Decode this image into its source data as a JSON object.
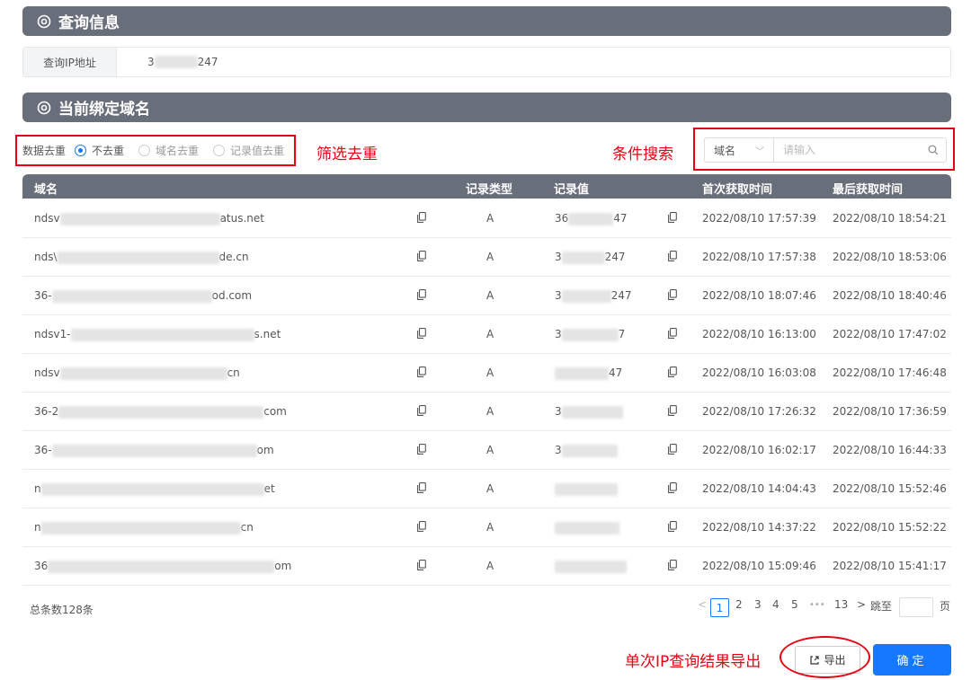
{
  "query_section": {
    "title": "查询信息",
    "ip_label": "查询IP地址",
    "ip_value_prefix": "3",
    "ip_value_suffix": "247"
  },
  "domains_section": {
    "title": "当前绑定域名"
  },
  "filter": {
    "label": "数据去重",
    "options": [
      {
        "label": "不去重",
        "checked": true
      },
      {
        "label": "域名去重",
        "checked": false
      },
      {
        "label": "记录值去重",
        "checked": false
      }
    ]
  },
  "annotations": {
    "filter": "筛选去重",
    "search": "条件搜索",
    "export": "单次IP查询结果导出"
  },
  "search": {
    "field": "域名",
    "placeholder": "请输入"
  },
  "table": {
    "columns": [
      "域名",
      "记录类型",
      "记录值",
      "首次获取时间",
      "最后获取时间"
    ],
    "rows": [
      {
        "domain_start": "ndsv",
        "domain_end": "atus.net",
        "type": "A",
        "value_start": "36",
        "value_end": "47",
        "first": "2022/08/10 17:57:39",
        "last": "2022/08/10 18:54:21"
      },
      {
        "domain_start": "nds\\",
        "domain_end": "de.cn",
        "type": "A",
        "value_start": "3",
        "value_end": "247",
        "first": "2022/08/10 17:57:38",
        "last": "2022/08/10 18:53:06"
      },
      {
        "domain_start": "36-",
        "domain_end": "od.com",
        "type": "A",
        "value_start": "3",
        "value_end": "247",
        "first": "2022/08/10 18:07:46",
        "last": "2022/08/10 18:40:46"
      },
      {
        "domain_start": "ndsv1-",
        "domain_end": "s.net",
        "type": "A",
        "value_start": "3",
        "value_end": "7",
        "first": "2022/08/10 16:13:00",
        "last": "2022/08/10 17:47:02"
      },
      {
        "domain_start": "ndsv",
        "domain_end": "cn",
        "type": "A",
        "value_start": "",
        "value_end": "47",
        "first": "2022/08/10 16:03:08",
        "last": "2022/08/10 17:46:48"
      },
      {
        "domain_start": "36-2",
        "domain_end": "com",
        "type": "A",
        "value_start": "3",
        "value_end": "",
        "first": "2022/08/10 17:26:32",
        "last": "2022/08/10 17:36:59"
      },
      {
        "domain_start": "36-",
        "domain_end": "om",
        "type": "A",
        "value_start": "3",
        "value_end": "",
        "first": "2022/08/10 16:02:17",
        "last": "2022/08/10 16:44:33"
      },
      {
        "domain_start": "n",
        "domain_end": "et",
        "type": "A",
        "value_start": "",
        "value_end": "",
        "first": "2022/08/10 14:04:43",
        "last": "2022/08/10 15:52:46"
      },
      {
        "domain_start": "n",
        "domain_end": "cn",
        "type": "A",
        "value_start": "",
        "value_end": "",
        "first": "2022/08/10 14:37:22",
        "last": "2022/08/10 15:52:22"
      },
      {
        "domain_start": "36",
        "domain_end": "om",
        "type": "A",
        "value_start": "",
        "value_end": "",
        "first": "2022/08/10 15:09:46",
        "last": "2022/08/10 15:41:17"
      }
    ]
  },
  "pagination": {
    "total_text": "总条数128条",
    "prev": "<",
    "pages": [
      "1",
      "2",
      "3",
      "4",
      "5"
    ],
    "ellipsis": "•••",
    "last_page": "13",
    "next": ">",
    "jump_label": "跳至",
    "page_unit": "页"
  },
  "buttons": {
    "export": "导出",
    "confirm": "确定"
  },
  "colors": {
    "header_bg": "#696e7b",
    "accent": "#1677ff",
    "annotation": "#e60012"
  }
}
